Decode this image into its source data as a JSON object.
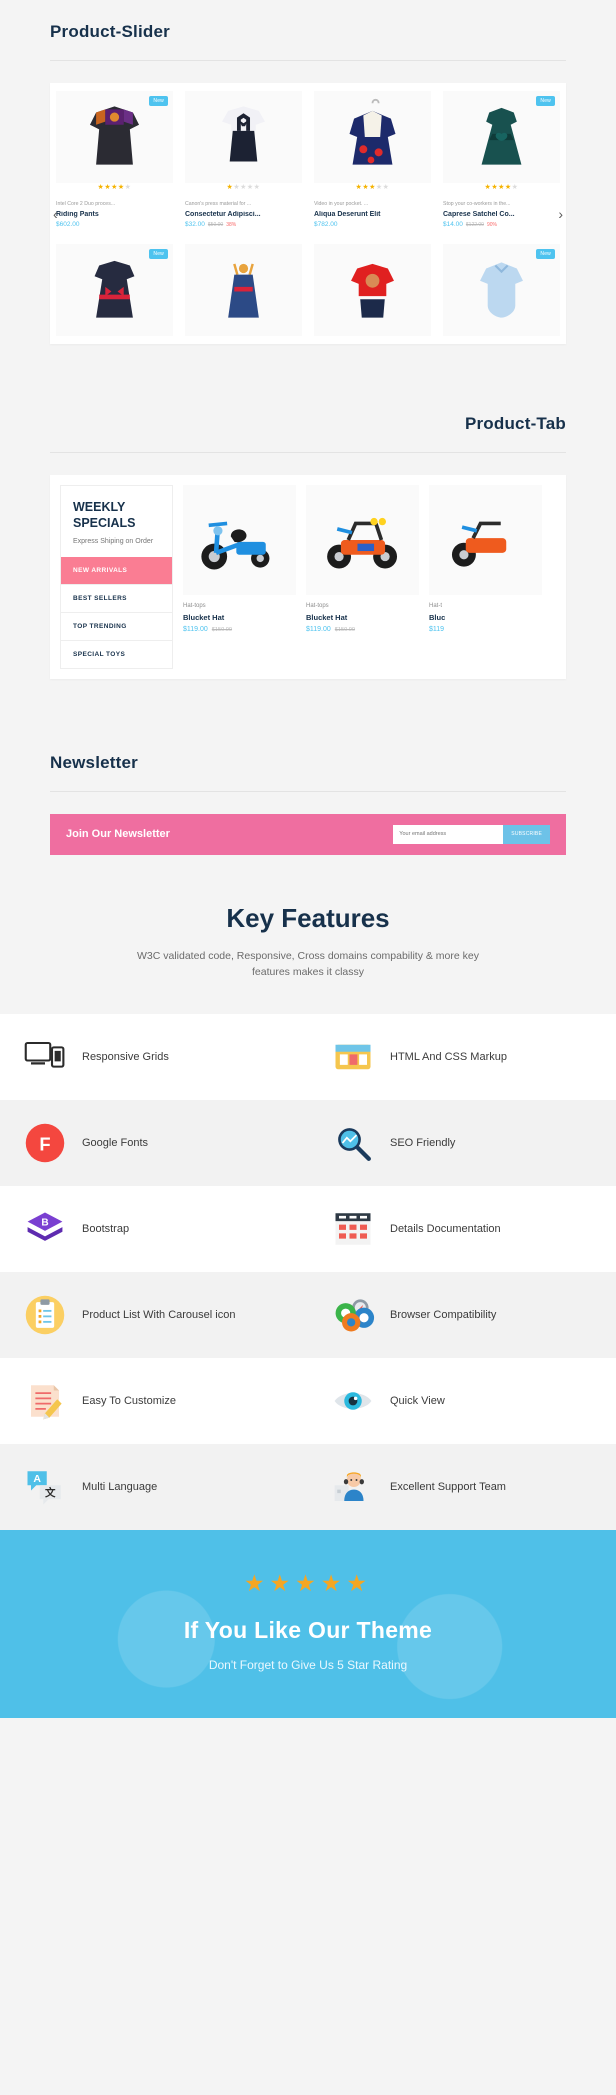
{
  "slider": {
    "heading": "Product-Slider",
    "prev_icon": "chevron-left-icon",
    "next_icon": "chevron-right-icon",
    "row1": [
      {
        "badge": "New",
        "rating": 4,
        "desc": "Intel Core 2 Duo proces...",
        "name": "Riding Pants",
        "price": "$602.00",
        "old": "",
        "disc": ""
      },
      {
        "badge": "",
        "rating": 1,
        "desc": "Canon's press material for ...",
        "name": "Consectetur Adipisci...",
        "price": "$32.00",
        "old": "$50.00",
        "disc": "38%"
      },
      {
        "badge": "",
        "rating": 3,
        "desc": "Video in your pocket. ...",
        "name": "Aliqua Deserunt Elit",
        "price": "$782.00",
        "old": "",
        "disc": ""
      },
      {
        "badge": "New",
        "rating": 4,
        "desc": "Stop your co-workers in the...",
        "name": "Caprese Satchel Co...",
        "price": "$14.00",
        "old": "$122.00",
        "disc": "90%"
      }
    ],
    "row2": [
      {
        "badge": "New"
      },
      {
        "badge": ""
      },
      {
        "badge": ""
      },
      {
        "badge": "New"
      }
    ]
  },
  "producttab": {
    "heading": "Product-Tab",
    "weekly_title": "WEEKLY SPECIALS",
    "weekly_sub": "Express Shiping on Order",
    "tabs": [
      {
        "label": "NEW ARRIVALS",
        "active": true
      },
      {
        "label": "BEST SELLERS",
        "active": false
      },
      {
        "label": "TOP TRENDING",
        "active": false
      },
      {
        "label": "SPECIAL TOYS",
        "active": false
      }
    ],
    "products": [
      {
        "desc": "Hat-tops",
        "name": "Blucket Hat",
        "price": "$119.00",
        "old": "$150.00"
      },
      {
        "desc": "Hat-tops",
        "name": "Blucket Hat",
        "price": "$119.00",
        "old": "$150.00"
      },
      {
        "desc": "Hat-t",
        "name": "Bluc",
        "price": "$119",
        "old": ""
      }
    ]
  },
  "newsletter": {
    "heading": "Newsletter",
    "title": "Join Our Newsletter",
    "placeholder": "Your email address",
    "button": "SUBSCRIBE"
  },
  "keyfeatures": {
    "heading": "Key Features",
    "subheading": "W3C validated code, Responsive, Cross domains compability & more key features makes it classy",
    "items": [
      {
        "icon": "devices-icon",
        "label": "Responsive Grids"
      },
      {
        "icon": "html-css-markup-icon",
        "label": "HTML And CSS Markup"
      },
      {
        "icon": "google-fonts-icon",
        "label": "Google Fonts"
      },
      {
        "icon": "seo-magnifier-icon",
        "label": "SEO Friendly"
      },
      {
        "icon": "bootstrap-icon",
        "label": "Bootstrap"
      },
      {
        "icon": "documentation-icon",
        "label": "Details Documentation"
      },
      {
        "icon": "clipboard-list-icon",
        "label": "Product List With Carousel icon"
      },
      {
        "icon": "browsers-icon",
        "label": "Browser Compatibility"
      },
      {
        "icon": "pencil-note-icon",
        "label": "Easy To Customize"
      },
      {
        "icon": "eye-icon",
        "label": "Quick View"
      },
      {
        "icon": "translate-icon",
        "label": "Multi Language"
      },
      {
        "icon": "support-agent-icon",
        "label": "Excellent Support Team"
      }
    ]
  },
  "rating_banner": {
    "stars": "★★★★★",
    "title": "If You Like Our Theme",
    "subtitle": "Don't Forget to Give Us 5 Star Rating",
    "bg_color": "#4fc0e8",
    "star_color": "#f5a623"
  }
}
